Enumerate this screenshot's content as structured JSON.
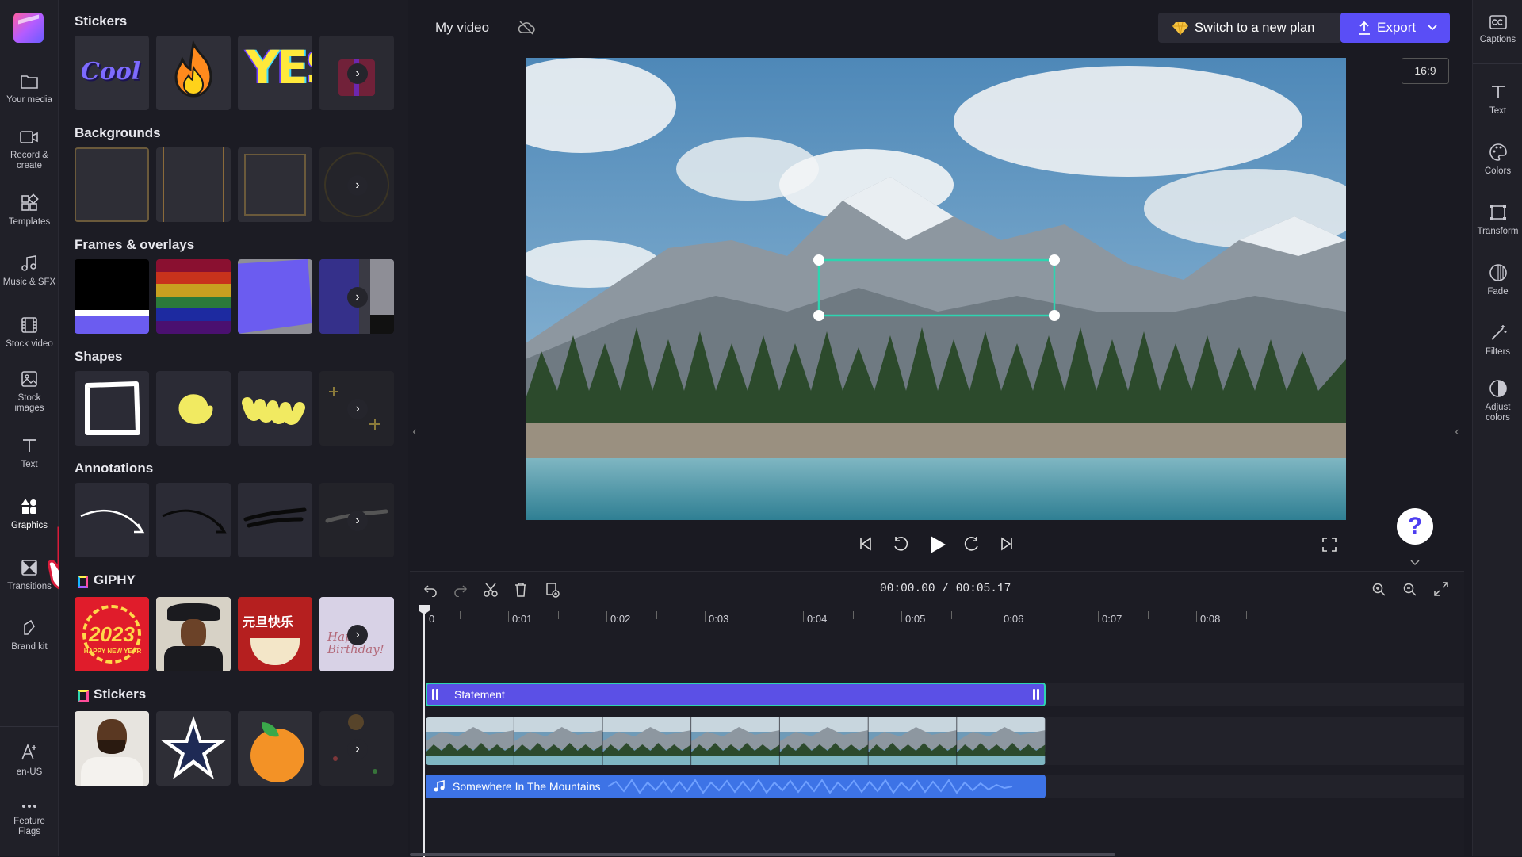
{
  "rail": {
    "items": [
      {
        "label": "Your media",
        "icon": "folder-icon"
      },
      {
        "label": "Record & create",
        "icon": "camera-icon"
      },
      {
        "label": "Templates",
        "icon": "templates-icon"
      },
      {
        "label": "Music & SFX",
        "icon": "music-icon"
      },
      {
        "label": "Stock video",
        "icon": "film-icon"
      },
      {
        "label": "Stock images",
        "icon": "image-icon"
      },
      {
        "label": "Text",
        "icon": "text-icon"
      },
      {
        "label": "Graphics",
        "icon": "shapes-icon"
      },
      {
        "label": "Transitions",
        "icon": "transitions-icon"
      },
      {
        "label": "Brand kit",
        "icon": "brand-icon"
      },
      {
        "label": "en-US",
        "icon": "language-icon"
      },
      {
        "label": "Feature Flags",
        "icon": "more-icon"
      }
    ]
  },
  "panel": {
    "sections": [
      {
        "title": "Stickers"
      },
      {
        "title": "Backgrounds"
      },
      {
        "title": "Frames & overlays"
      },
      {
        "title": "Shapes"
      },
      {
        "title": "Annotations"
      },
      {
        "title": "GIPHY"
      },
      {
        "title": "Stickers"
      }
    ],
    "sticker_texts": {
      "cool": "Cool",
      "yes": "YES"
    },
    "giphy_texts": {
      "year": "2023",
      "new_year": "HAPPY NEW YEAR",
      "chinese": "元旦快乐",
      "birthday": "Happy Birthday!"
    }
  },
  "topbar": {
    "project_name": "My video",
    "plan_label": "Switch to a new plan",
    "export_label": "Export",
    "aspect_ratio": "16:9"
  },
  "right_rail": {
    "items": [
      {
        "label": "Captions",
        "icon": "captions-icon"
      },
      {
        "label": "Text",
        "icon": "text-icon"
      },
      {
        "label": "Colors",
        "icon": "palette-icon"
      },
      {
        "label": "Transform",
        "icon": "transform-icon"
      },
      {
        "label": "Fade",
        "icon": "fade-icon"
      },
      {
        "label": "Filters",
        "icon": "filters-icon"
      },
      {
        "label": "Adjust colors",
        "icon": "adjust-colors-icon"
      }
    ]
  },
  "timeline": {
    "current_time": "00:00.00",
    "separator": "/",
    "total_time": "00:05.17",
    "ruler": [
      "0",
      "0:01",
      "0:02",
      "0:03",
      "0:04",
      "0:05",
      "0:06",
      "0:07",
      "0:08"
    ],
    "tracks": {
      "text_clip": "Statement",
      "audio_clip": "Somewhere In The Mountains"
    }
  },
  "help_label": "?",
  "colors": {
    "accent": "#5a4ef6",
    "selection": "#2ed4b0",
    "audio": "#3d73e6"
  }
}
